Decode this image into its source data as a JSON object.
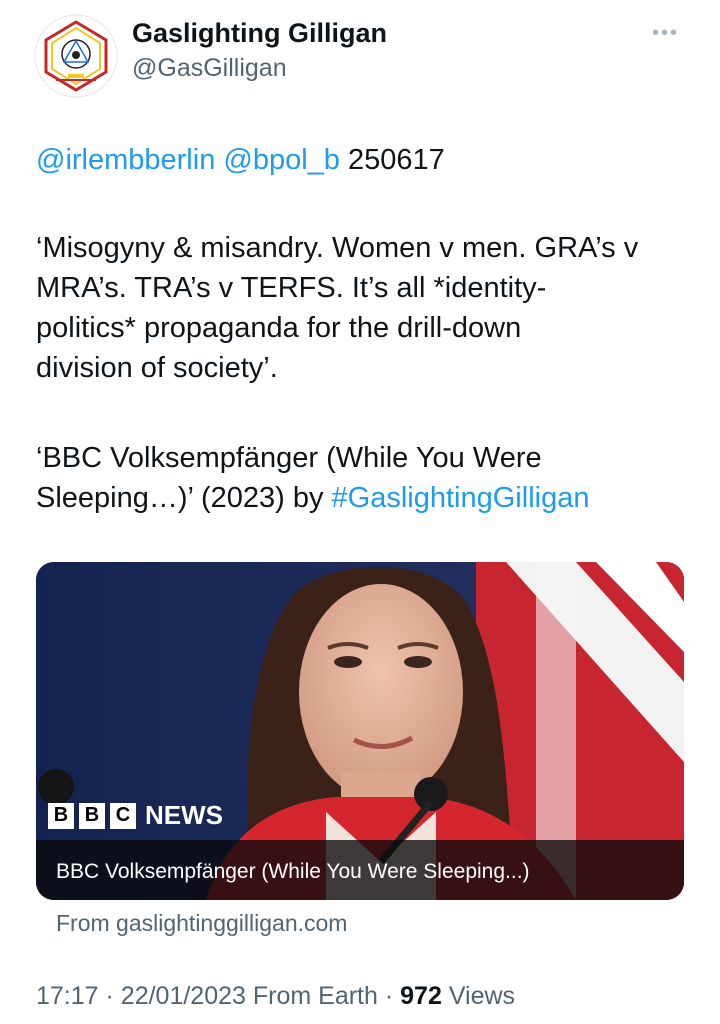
{
  "author": {
    "display_name": "Gaslighting Gilligan",
    "handle": "@GasGilligan",
    "more_icon": "more-horizontal-icon"
  },
  "tweet": {
    "mention_1": "@irlembberlin",
    "mention_2": "@bpol_b",
    "code": "250617",
    "quote_lines": [
      "‘Misogyny & misandry. Women v men. GRA’s v",
      "MRA’s. TRA’s v TERFS. It’s all *identity-",
      "politics* propaganda for the drill-down",
      "division of society’."
    ],
    "title_line_1": "‘BBC Volksempfänger (While You Were",
    "title_line_2": "Sleeping…)’ (2023) by",
    "hashtag": "#GaslightingGilligan"
  },
  "card": {
    "logo_letters": [
      "B",
      "B",
      "C"
    ],
    "logo_word": "NEWS",
    "caption": "BBC Volksempfänger (While You Were Sleeping...)",
    "source": "From gaslightinggilligan.com"
  },
  "meta": {
    "time": "17:17",
    "date": "22/01/2023",
    "client": "From Earth",
    "views_count": "972",
    "views_label": "Views"
  },
  "colors": {
    "link": "#1d9bf0",
    "secondary_text": "#536471",
    "primary_text": "#0f1419"
  }
}
